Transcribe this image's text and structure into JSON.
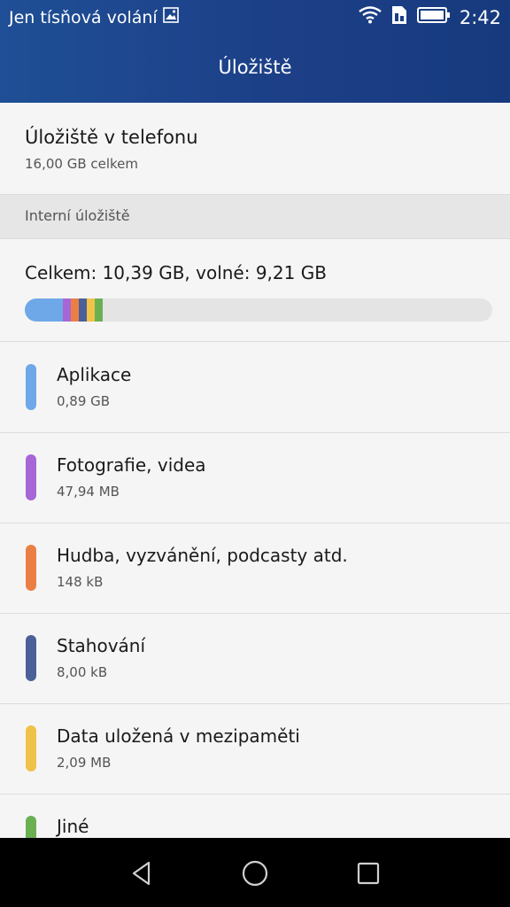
{
  "status_bar": {
    "carrier": "Jen tísňová volání",
    "time": "2:42"
  },
  "header": {
    "title": "Úložiště"
  },
  "phone_storage": {
    "title": "Úložiště v telefonu",
    "subtitle": "16,00  GB celkem"
  },
  "section": {
    "label": "Interní úložiště"
  },
  "summary": {
    "text": "Celkem: 10,39 GB, volné: 9,21 GB",
    "segments": [
      {
        "color": "#6ea8e8",
        "fraction": 0.081
      },
      {
        "color": "#a666d6",
        "fraction": 0.017
      },
      {
        "color": "#ea7f45",
        "fraction": 0.017
      },
      {
        "color": "#4b5f98",
        "fraction": 0.017
      },
      {
        "color": "#f0c24a",
        "fraction": 0.017
      },
      {
        "color": "#6ab053",
        "fraction": 0.017
      }
    ]
  },
  "categories": [
    {
      "name": "Aplikace",
      "value": "0,89 GB",
      "color": "#6ea8e8"
    },
    {
      "name": "Fotografie, videa",
      "value": "47,94 MB",
      "color": "#a666d6"
    },
    {
      "name": "Hudba, vyzvánění, podcasty atd.",
      "value": "148 kB",
      "color": "#ea7f45"
    },
    {
      "name": "Stahování",
      "value": "8,00 kB",
      "color": "#4b5f98"
    },
    {
      "name": "Data uložená v mezipaměti",
      "value": "2,09 MB",
      "color": "#f0c24a"
    },
    {
      "name": "Jiné",
      "value": "",
      "color": "#6ab053"
    }
  ],
  "icons": {
    "status": [
      "image-icon",
      "wifi-icon",
      "sim-icon",
      "battery-icon"
    ],
    "nav": [
      "back-icon",
      "home-icon",
      "recents-icon"
    ]
  }
}
